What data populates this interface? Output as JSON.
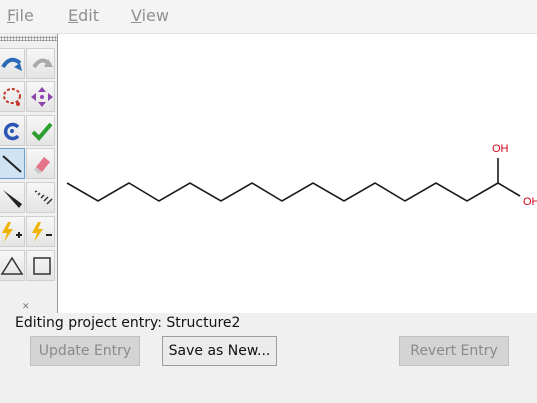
{
  "menu": [
    {
      "label": "File",
      "mnemonic": "F",
      "rest": "ile"
    },
    {
      "label": "Edit",
      "mnemonic": "E",
      "rest": "dit"
    },
    {
      "label": "View",
      "mnemonic": "V",
      "rest": "iew"
    }
  ],
  "molecule": {
    "atom_labels": [
      "OH",
      "OH"
    ],
    "heteroatom_color": "#d0021b"
  },
  "status": {
    "text": "Editing project entry: Structure2"
  },
  "buttons": {
    "update": {
      "label": "Update Entry",
      "enabled": false
    },
    "save_new": {
      "label": "Save as New...",
      "enabled": true
    },
    "revert": {
      "label": "Revert Entry",
      "enabled": false
    }
  }
}
